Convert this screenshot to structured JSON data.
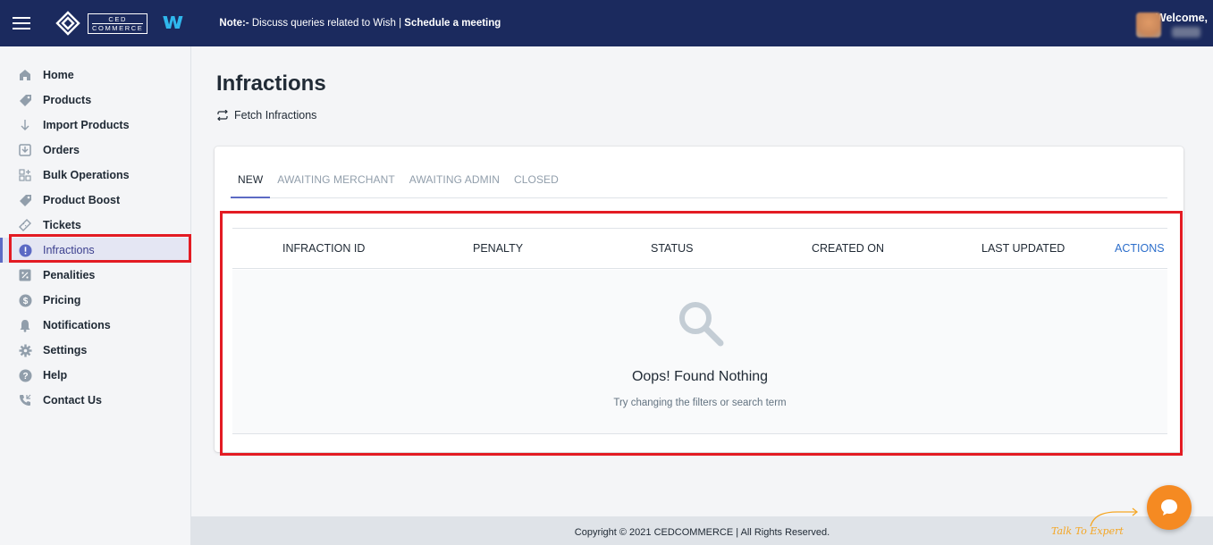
{
  "header": {
    "logo_top": "CED",
    "logo_bottom": "COMMERCE",
    "wish_logo": "w",
    "note_prefix": "Note:-",
    "note_text": " Discuss queries related to Wish | ",
    "note_link": "Schedule a meeting",
    "welcome": "Welcome,"
  },
  "sidebar": {
    "items": [
      {
        "label": "Home",
        "icon": "home-icon"
      },
      {
        "label": "Products",
        "icon": "tag-icon"
      },
      {
        "label": "Import Products",
        "icon": "arrow-down-icon"
      },
      {
        "label": "Orders",
        "icon": "inbox-icon"
      },
      {
        "label": "Bulk Operations",
        "icon": "grid-plus-icon"
      },
      {
        "label": "Product Boost",
        "icon": "tag-icon"
      },
      {
        "label": "Tickets",
        "icon": "ticket-icon"
      },
      {
        "label": "Infractions",
        "icon": "alert-circle-icon",
        "active": true
      },
      {
        "label": "Penalities",
        "icon": "percent-icon"
      },
      {
        "label": "Pricing",
        "icon": "dollar-icon"
      },
      {
        "label": "Notifications",
        "icon": "bell-icon"
      },
      {
        "label": "Settings",
        "icon": "gear-icon"
      },
      {
        "label": "Help",
        "icon": "question-icon"
      },
      {
        "label": "Contact Us",
        "icon": "phone-icon"
      }
    ]
  },
  "main": {
    "title": "Infractions",
    "fetch_label": "Fetch Infractions",
    "tabs": [
      {
        "label": "NEW",
        "active": true
      },
      {
        "label": "AWAITING MERCHANT"
      },
      {
        "label": "AWAITING ADMIN"
      },
      {
        "label": "CLOSED"
      }
    ],
    "columns": [
      "INFRACTION ID",
      "PENALTY",
      "STATUS",
      "CREATED ON",
      "LAST UPDATED",
      "ACTIONS"
    ],
    "empty_title": "Oops! Found Nothing",
    "empty_subtitle": "Try changing the filters or search term"
  },
  "footer": {
    "copyright": "Copyright © 2021 CEDCOMMERCE | All Rights Reserved.",
    "talk_to_expert": "Talk To Expert"
  },
  "colors": {
    "topbar": "#1b2a5e",
    "accent": "#5c6ac4",
    "highlight": "#e31b23",
    "chat": "#f58a22",
    "link": "#2c6ecb"
  }
}
